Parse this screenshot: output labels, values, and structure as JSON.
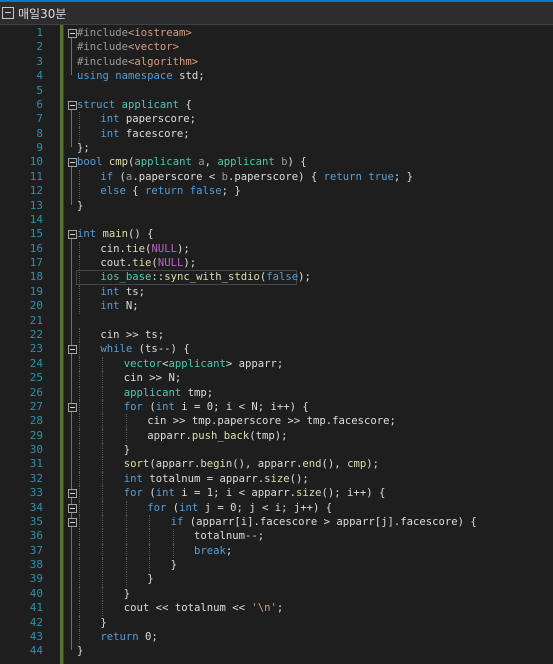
{
  "tab": {
    "title": "매일30분"
  },
  "lines": [
    {
      "n": "1",
      "fold": true,
      "tokens": [
        [
          "pp",
          "#include"
        ],
        [
          "inc",
          "<iostream>"
        ]
      ]
    },
    {
      "n": "2",
      "tokens": [
        [
          "pp",
          "#include"
        ],
        [
          "inc",
          "<vector>"
        ]
      ]
    },
    {
      "n": "3",
      "tokens": [
        [
          "pp",
          "#include"
        ],
        [
          "inc",
          "<algorithm>"
        ]
      ]
    },
    {
      "n": "4",
      "tokens": [
        [
          "kw",
          "using namespace "
        ],
        [
          "var",
          "std;"
        ]
      ]
    },
    {
      "n": "5",
      "tokens": []
    },
    {
      "n": "6",
      "fold": true,
      "tokens": [
        [
          "kw",
          "struct "
        ],
        [
          "ty",
          "applicant"
        ],
        [
          "var",
          " {"
        ]
      ]
    },
    {
      "n": "7",
      "indent": 1,
      "tokens": [
        [
          "kw",
          "int "
        ],
        [
          "var",
          "paperscore;"
        ]
      ]
    },
    {
      "n": "8",
      "indent": 1,
      "tokens": [
        [
          "kw",
          "int "
        ],
        [
          "var",
          "facescore;"
        ]
      ]
    },
    {
      "n": "9",
      "tokens": [
        [
          "var",
          "};"
        ]
      ]
    },
    {
      "n": "10",
      "fold": true,
      "tokens": [
        [
          "kw",
          "bool "
        ],
        [
          "fn",
          "cmp"
        ],
        [
          "var",
          "("
        ],
        [
          "ty",
          "applicant "
        ],
        [
          "par",
          "a"
        ],
        [
          "var",
          ", "
        ],
        [
          "ty",
          "applicant "
        ],
        [
          "par",
          "b"
        ],
        [
          "var",
          ") {"
        ]
      ]
    },
    {
      "n": "11",
      "indent": 1,
      "tokens": [
        [
          "kw",
          "if "
        ],
        [
          "var",
          "("
        ],
        [
          "par",
          "a"
        ],
        [
          "var",
          ".paperscore < "
        ],
        [
          "par",
          "b"
        ],
        [
          "var",
          ".paperscore) { "
        ],
        [
          "kw",
          "return true"
        ],
        [
          "var",
          "; }"
        ]
      ]
    },
    {
      "n": "12",
      "indent": 1,
      "tokens": [
        [
          "kw",
          "else "
        ],
        [
          "var",
          "{ "
        ],
        [
          "kw",
          "return false"
        ],
        [
          "var",
          "; }"
        ]
      ]
    },
    {
      "n": "13",
      "tokens": [
        [
          "var",
          "}"
        ]
      ]
    },
    {
      "n": "14",
      "tokens": []
    },
    {
      "n": "15",
      "fold": true,
      "tokens": [
        [
          "kw",
          "int "
        ],
        [
          "fn",
          "main"
        ],
        [
          "var",
          "() {"
        ]
      ]
    },
    {
      "n": "16",
      "indent": 1,
      "tokens": [
        [
          "var",
          "cin."
        ],
        [
          "fn",
          "tie"
        ],
        [
          "var",
          "("
        ],
        [
          "mac",
          "NULL"
        ],
        [
          "var",
          ");"
        ]
      ]
    },
    {
      "n": "17",
      "indent": 1,
      "tokens": [
        [
          "var",
          "cout."
        ],
        [
          "fn",
          "tie"
        ],
        [
          "var",
          "("
        ],
        [
          "mac",
          "NULL"
        ],
        [
          "var",
          ");"
        ]
      ]
    },
    {
      "n": "18",
      "indent": 1,
      "hl": true,
      "tokens": [
        [
          "ty",
          "ios_base"
        ],
        [
          "var",
          "::"
        ],
        [
          "fn",
          "sync_with_stdio"
        ],
        [
          "var",
          "("
        ],
        [
          "kw",
          "false"
        ],
        [
          "var",
          ");"
        ]
      ]
    },
    {
      "n": "19",
      "indent": 1,
      "tokens": [
        [
          "kw",
          "int "
        ],
        [
          "var",
          "ts;"
        ]
      ]
    },
    {
      "n": "20",
      "indent": 1,
      "tokens": [
        [
          "kw",
          "int "
        ],
        [
          "var",
          "N;"
        ]
      ]
    },
    {
      "n": "21",
      "tokens": []
    },
    {
      "n": "22",
      "indent": 1,
      "tokens": [
        [
          "var",
          "cin >> ts;"
        ]
      ]
    },
    {
      "n": "23",
      "indent": 1,
      "fold": true,
      "tokens": [
        [
          "kw",
          "while "
        ],
        [
          "var",
          "(ts--) {"
        ]
      ]
    },
    {
      "n": "24",
      "indent": 2,
      "tokens": [
        [
          "ty",
          "vector"
        ],
        [
          "var",
          "<"
        ],
        [
          "ty",
          "applicant"
        ],
        [
          "var",
          "> apparr;"
        ]
      ]
    },
    {
      "n": "25",
      "indent": 2,
      "tokens": [
        [
          "var",
          "cin >> N;"
        ]
      ]
    },
    {
      "n": "26",
      "indent": 2,
      "tokens": [
        [
          "ty",
          "applicant "
        ],
        [
          "var",
          "tmp;"
        ]
      ]
    },
    {
      "n": "27",
      "indent": 2,
      "fold": true,
      "tokens": [
        [
          "kw",
          "for "
        ],
        [
          "var",
          "("
        ],
        [
          "kw",
          "int "
        ],
        [
          "var",
          "i = 0; i < N; i++) {"
        ]
      ]
    },
    {
      "n": "28",
      "indent": 3,
      "tokens": [
        [
          "var",
          "cin >> tmp.paperscore >> tmp.facescore;"
        ]
      ]
    },
    {
      "n": "29",
      "indent": 3,
      "tokens": [
        [
          "var",
          "apparr."
        ],
        [
          "fn",
          "push_back"
        ],
        [
          "var",
          "(tmp);"
        ]
      ]
    },
    {
      "n": "30",
      "indent": 2,
      "tokens": [
        [
          "var",
          "}"
        ]
      ]
    },
    {
      "n": "31",
      "indent": 2,
      "tokens": [
        [
          "fn",
          "sort"
        ],
        [
          "var",
          "(apparr."
        ],
        [
          "fn",
          "begin"
        ],
        [
          "var",
          "(), apparr."
        ],
        [
          "fn",
          "end"
        ],
        [
          "var",
          "(), "
        ],
        [
          "fn",
          "cmp"
        ],
        [
          "var",
          ");"
        ]
      ]
    },
    {
      "n": "32",
      "indent": 2,
      "tokens": [
        [
          "kw",
          "int "
        ],
        [
          "var",
          "totalnum = apparr."
        ],
        [
          "fn",
          "size"
        ],
        [
          "var",
          "();"
        ]
      ]
    },
    {
      "n": "33",
      "indent": 2,
      "fold": true,
      "tokens": [
        [
          "kw",
          "for "
        ],
        [
          "var",
          "("
        ],
        [
          "kw",
          "int "
        ],
        [
          "var",
          "i = 1; i < apparr."
        ],
        [
          "fn",
          "size"
        ],
        [
          "var",
          "(); i++) {"
        ]
      ]
    },
    {
      "n": "34",
      "indent": 3,
      "fold": true,
      "tokens": [
        [
          "kw",
          "for "
        ],
        [
          "var",
          "("
        ],
        [
          "kw",
          "int "
        ],
        [
          "var",
          "j = 0; j < i; j++) {"
        ]
      ]
    },
    {
      "n": "35",
      "indent": 4,
      "fold": true,
      "tokens": [
        [
          "kw",
          "if "
        ],
        [
          "var",
          "(apparr[i].facescore > apparr[j].facescore) {"
        ]
      ]
    },
    {
      "n": "36",
      "indent": 5,
      "tokens": [
        [
          "var",
          "totalnum--;"
        ]
      ]
    },
    {
      "n": "37",
      "indent": 5,
      "tokens": [
        [
          "kw",
          "break"
        ],
        [
          "var",
          ";"
        ]
      ]
    },
    {
      "n": "38",
      "indent": 4,
      "tokens": [
        [
          "var",
          "}"
        ]
      ]
    },
    {
      "n": "39",
      "indent": 3,
      "tokens": [
        [
          "var",
          "}"
        ]
      ]
    },
    {
      "n": "40",
      "indent": 2,
      "tokens": [
        [
          "var",
          "}"
        ]
      ]
    },
    {
      "n": "41",
      "indent": 2,
      "tokens": [
        [
          "var",
          "cout << totalnum << "
        ],
        [
          "str",
          "'\\n'"
        ],
        [
          "var",
          ";"
        ]
      ]
    },
    {
      "n": "42",
      "indent": 1,
      "tokens": [
        [
          "var",
          "}"
        ]
      ]
    },
    {
      "n": "43",
      "indent": 1,
      "tokens": [
        [
          "kw",
          "return "
        ],
        [
          "var",
          "0;"
        ]
      ]
    },
    {
      "n": "44",
      "tokens": [
        [
          "var",
          "}"
        ]
      ]
    }
  ]
}
